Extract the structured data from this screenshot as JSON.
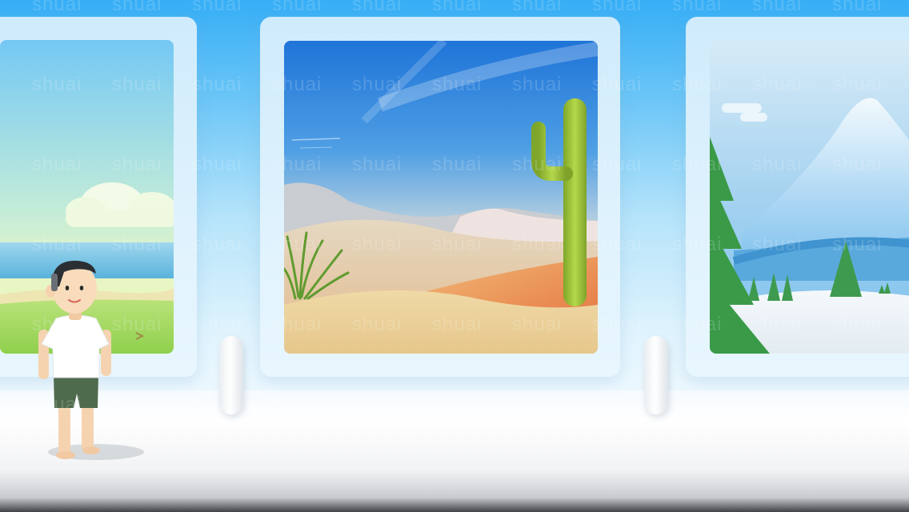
{
  "watermark": {
    "text": "shuai"
  },
  "paintings": [
    {
      "scene": "beach-meadow"
    },
    {
      "scene": "desert-cactus"
    },
    {
      "scene": "snowy-mountain-forest"
    }
  ],
  "colors": {
    "sky_top": "#36aef6",
    "frame": "#d7eefc",
    "floor": "#ffffff",
    "sand": "#e8cd92",
    "cactus": "#9cc23a",
    "pine": "#3e9a4f",
    "shirt": "#ffffff",
    "shorts": "#4f6b4d"
  }
}
